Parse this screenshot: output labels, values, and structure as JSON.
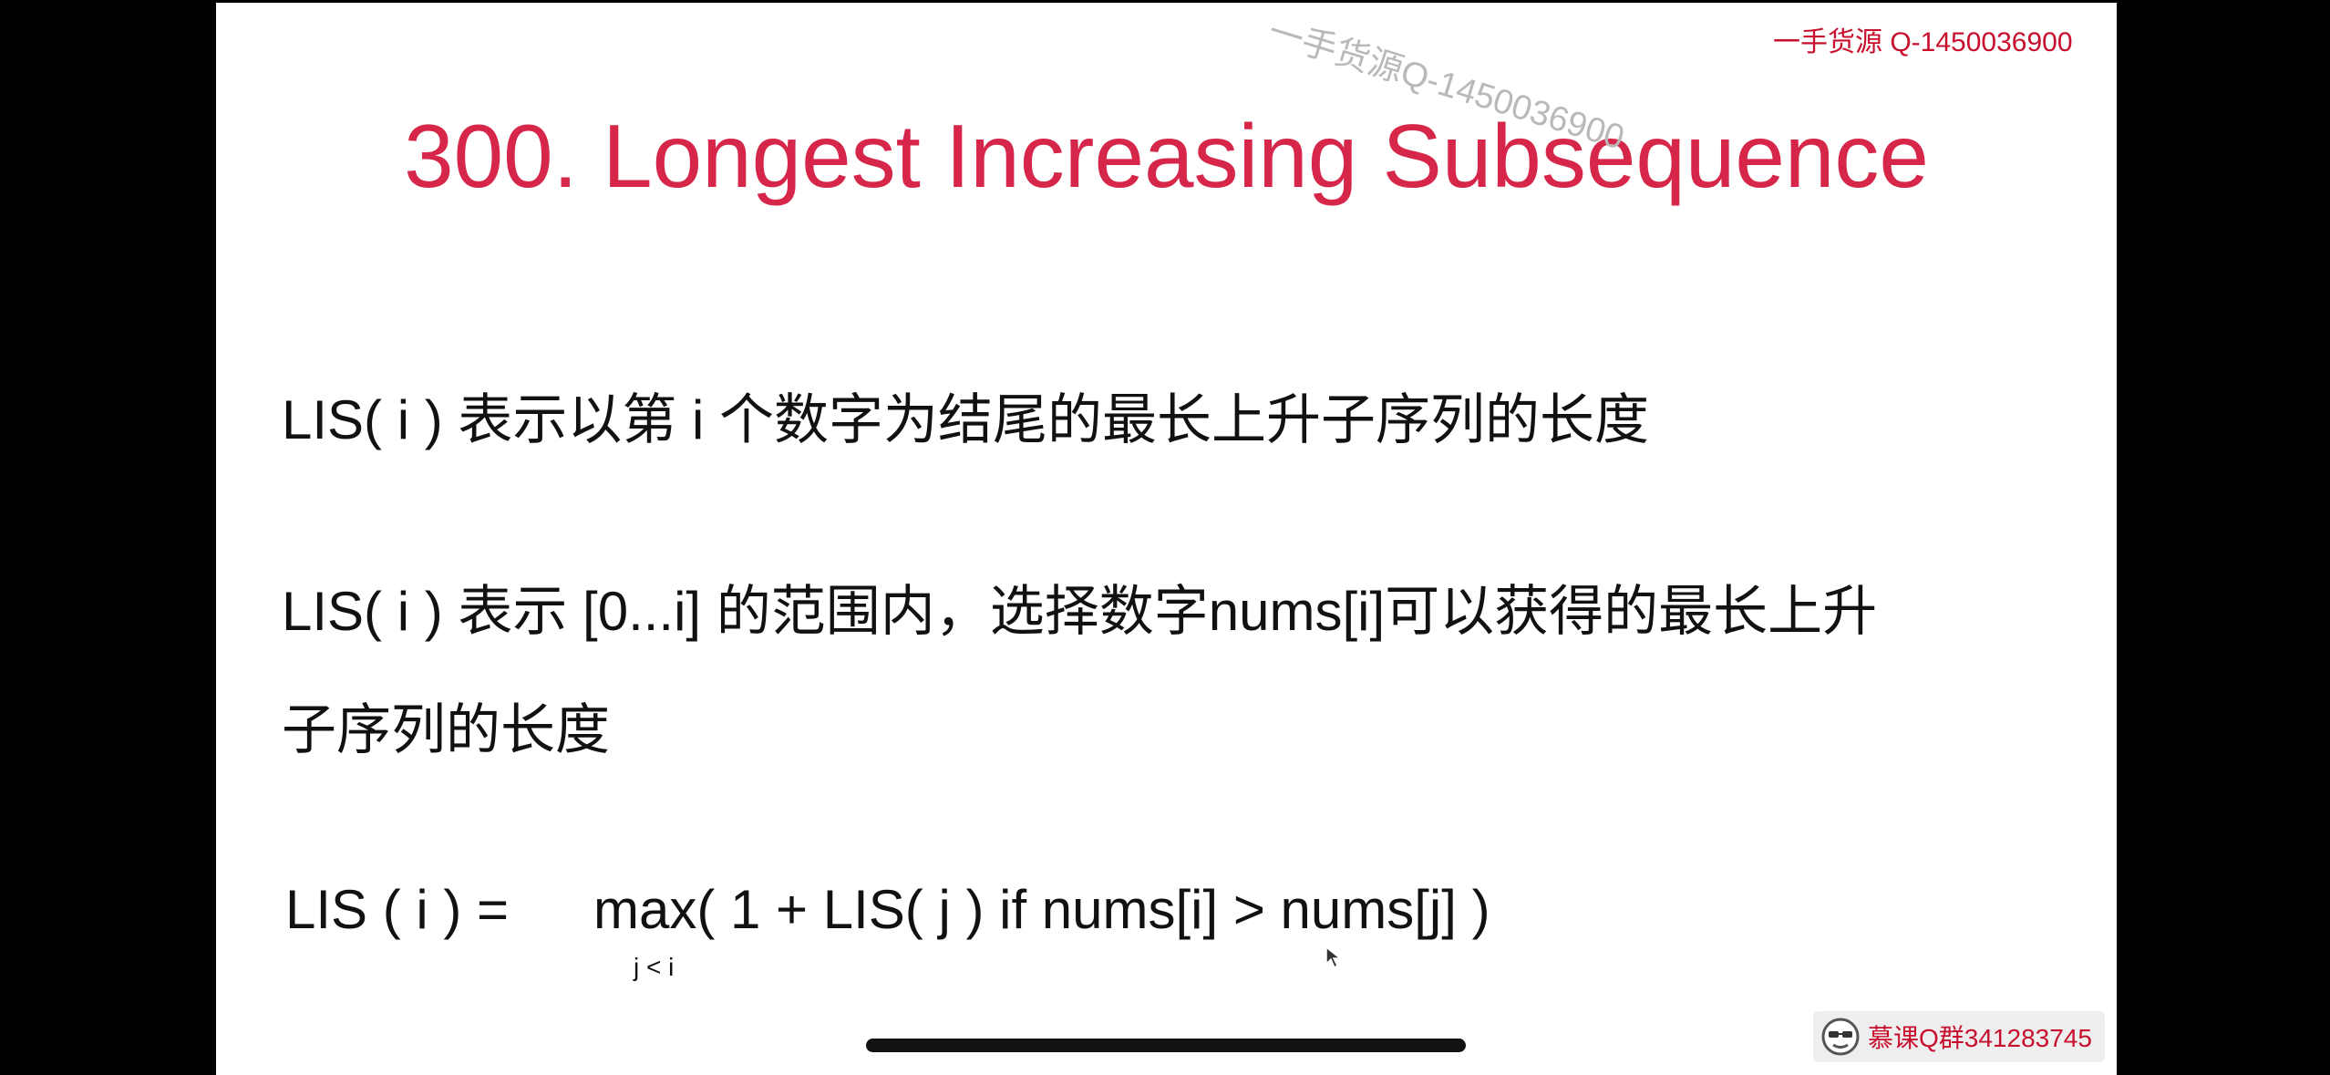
{
  "slide": {
    "title": "300. Longest Increasing Subsequence",
    "definition_1": "LIS( i ) 表示以第 i 个数字为结尾的最长上升子序列的长度",
    "definition_2_line1": "LIS( i ) 表示 [0...i] 的范围内，选择数字nums[i]可以获得的最长上升",
    "definition_2_line2": "子序列的长度",
    "formula_lhs": "LIS ( i )  =",
    "formula_rhs": "max( 1 + LIS( j ) if nums[i] > nums[j] )",
    "formula_subscript": "j < i"
  },
  "watermarks": {
    "top_right": "一手货源 Q-1450036900",
    "diagonal": "一手货源Q-1450036900",
    "bottom_right": "慕课Q群341283745"
  },
  "icons": {
    "bottom_logo": "face-logo-icon",
    "cursor": "mouse-pointer-icon"
  },
  "colors": {
    "title": "#d6274a",
    "watermark": "#c8102e",
    "background": "#000000",
    "slide": "#ffffff"
  }
}
